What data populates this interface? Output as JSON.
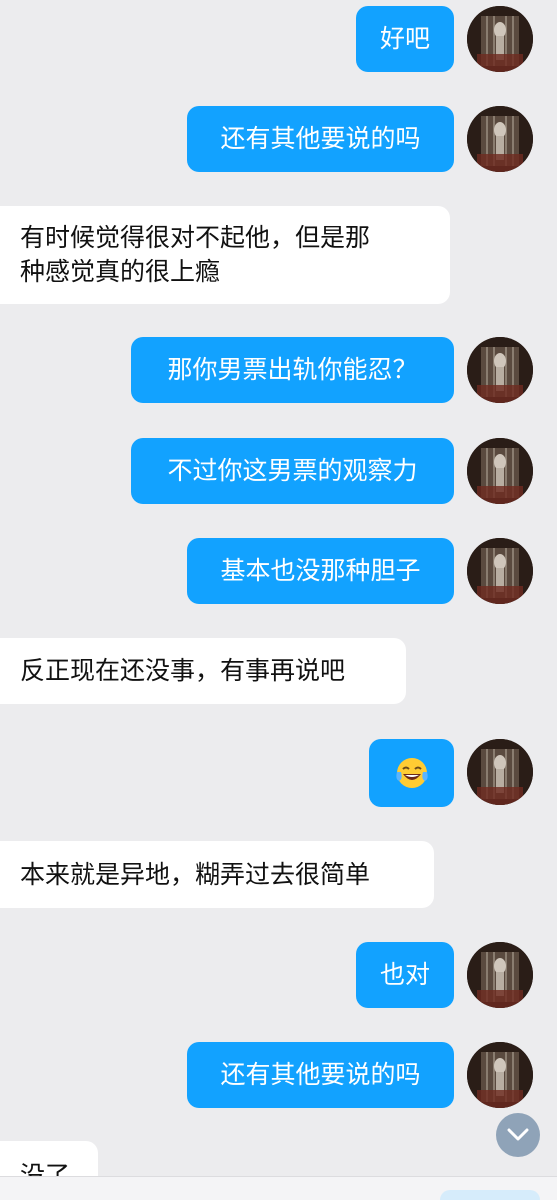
{
  "colors": {
    "background": "#ececee",
    "outgoing_bubble": "#12a2ff",
    "outgoing_text": "#ffffff",
    "incoming_bubble": "#ffffff",
    "incoming_text": "#111111"
  },
  "messages": [
    {
      "side": "out",
      "text": "好吧"
    },
    {
      "side": "out",
      "text": "还有其他要说的吗"
    },
    {
      "side": "in",
      "text": "有时候觉得很对不起他，但是那\n种感觉真的很上瘾"
    },
    {
      "side": "out",
      "text": "那你男票出轨你能忍？"
    },
    {
      "side": "out",
      "text": "不过你这男票的观察力"
    },
    {
      "side": "out",
      "text": "基本也没那种胆子"
    },
    {
      "side": "in",
      "text": "反正现在还没事，有事再说吧"
    },
    {
      "side": "out",
      "emoji": "tears-of-joy-emoji"
    },
    {
      "side": "in",
      "text": "本来就是异地，糊弄过去很简单"
    },
    {
      "side": "out",
      "text": "也对"
    },
    {
      "side": "out",
      "text": "还有其他要说的吗"
    },
    {
      "side": "in",
      "text": "没了"
    }
  ],
  "scroll_down_icon": "chevron-down-icon",
  "avatar_icon": "user-avatar"
}
